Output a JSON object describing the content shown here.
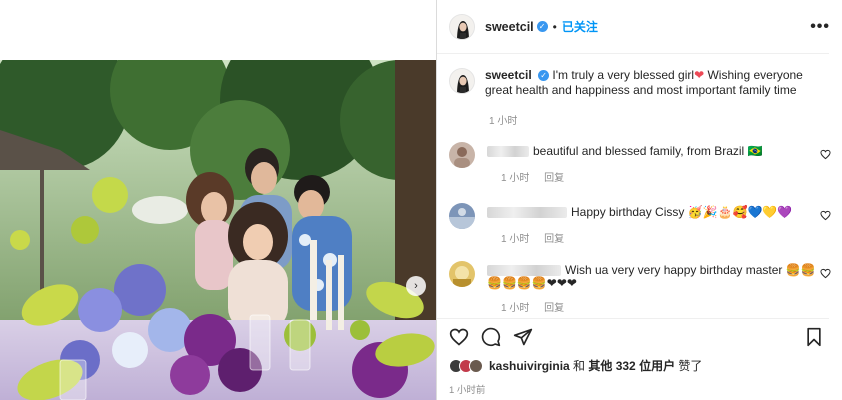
{
  "post": {
    "username": "sweetcil",
    "verified_mark": "✓",
    "separator": "•",
    "follow_status": "已关注",
    "more_label": "•••",
    "caption_pre": "I'm truly a very blessed girl",
    "caption_heart": "❤",
    "caption_post": " Wishing everyone great health and happiness and most important family time",
    "caption_time": "1 小时"
  },
  "comments": [
    {
      "text": "beautiful and blessed family, from Brazil 🇧🇷",
      "time": "1 小时",
      "reply": "回复",
      "avatar_color": "#b7a397"
    },
    {
      "text": "Happy birthday Cissy 🥳🎉🎂🥰💙💛💜",
      "time": "1 小时",
      "reply": "回复",
      "avatar_color": "#6d86a8"
    },
    {
      "text_line1": "Wish ua very very happy birthday master 🍔🍔",
      "text_line2": "🍔🍔🍔🍔❤❤❤",
      "time": "1 小时",
      "reply": "回复",
      "avatar_color": "#d9b14a"
    }
  ],
  "likes": {
    "first_liker": "kashuivirginia",
    "and": " 和 ",
    "others": "其他 332 位用户",
    "liked": " 赞了"
  },
  "post_time": "1 小时前",
  "colors": {
    "accent": "#0095f6",
    "verified": "#3897f0",
    "heart": "#ed4956",
    "muted": "#8e8e8e"
  },
  "icons": {
    "like": "heart-outline-icon",
    "comment": "comment-bubble-icon",
    "share": "paper-plane-icon",
    "save": "bookmark-icon",
    "next": "chevron-right-icon"
  }
}
